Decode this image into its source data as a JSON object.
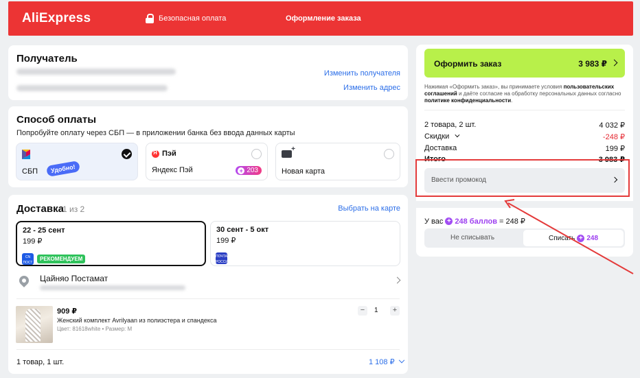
{
  "header": {
    "logo": "AliExpress",
    "secure_label": "Безопасная оплата",
    "title": "Оформление заказа"
  },
  "recipient": {
    "title": "Получатель",
    "change_recipient": "Изменить получателя",
    "change_address": "Изменить адрес"
  },
  "payment": {
    "title": "Способ оплаты",
    "hint": "Попробуйте оплату через СБП — в приложении банка без ввода данных карты",
    "options": [
      {
        "name": "СБП",
        "badge": "Удобно!",
        "selected": true
      },
      {
        "name": "Яндекс Пэй",
        "brand": "Пэй",
        "points": "203",
        "selected": false
      },
      {
        "name": "Новая карта",
        "selected": false
      }
    ]
  },
  "delivery": {
    "title": "Доставка",
    "steps": "1 из 2",
    "map_link": "Выбрать на карте",
    "slots": [
      {
        "dates": "22 - 25 сент",
        "price": "199 ₽",
        "badge": "РЕКОМЕНДУЕМ",
        "selected": true
      },
      {
        "dates": "30 сент - 5 окт",
        "price": "199 ₽",
        "selected": false
      }
    ],
    "pickup": "Цайняо Постамат",
    "item": {
      "price": "909 ₽",
      "title": "Женский комплект Avrilyaan из полиэстера и спандекса",
      "meta": "Цвет: 81618white • Размер: M",
      "qty": "1",
      "minus": "−",
      "plus": "+"
    },
    "footer_count": "1 товар, 1 шт.",
    "footer_total": "1 108 ₽"
  },
  "summary": {
    "order_button": "Оформить заказ",
    "order_total": "3 983 ₽",
    "legal_prefix": "Нажимая «Оформить заказ», вы принимаете условия ",
    "legal_link1": "пользовательских соглашений",
    "legal_mid": " и даёте согласие на обработку персональных данных согласно ",
    "legal_link2": "политике конфиденциальности",
    "legal_end": ".",
    "rows": [
      {
        "label": "2 товара, 2 шт.",
        "value": "4 032 ₽"
      },
      {
        "label": "Скидки",
        "value": "-248 ₽"
      },
      {
        "label": "Доставка",
        "value": "199 ₽"
      },
      {
        "label": "Итого",
        "value": "3 983 ₽"
      }
    ],
    "promo_placeholder": "Ввести промокод",
    "balance_prefix": "У вас",
    "balance_points": "248 баллов",
    "balance_suffix": "= 248 ₽",
    "toggle_off": "Не списывать",
    "toggle_on": "Списать",
    "toggle_points": "248"
  },
  "colors": {
    "header_red": "#ec3434",
    "order_green": "#b8f04a",
    "link_blue": "#2b6ee8",
    "points_purple": "#a24df3",
    "annotation_red": "#e43a3a"
  }
}
